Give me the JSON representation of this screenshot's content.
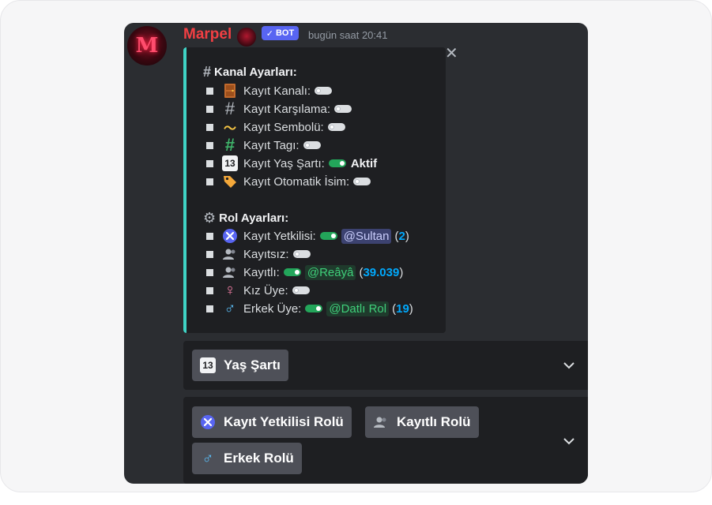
{
  "message": {
    "username": "Marpel",
    "bot_badge": "BOT",
    "timestamp": "bugün saat 20:41",
    "avatar_letter": "M"
  },
  "embed": {
    "channel_heading": "Kanal Ayarları:",
    "channel_items": [
      {
        "label": "Kayıt Kanalı:",
        "icon": "door-icon",
        "toggle": "off"
      },
      {
        "label": "Kayıt Karşılama:",
        "icon": "hash-icon",
        "toggle": "off"
      },
      {
        "label": "Kayıt Sembolü:",
        "icon": "tilde-icon",
        "toggle": "off"
      },
      {
        "label": "Kayıt Tagı:",
        "icon": "green-hash-icon",
        "toggle": "off"
      },
      {
        "label": "Kayıt Yaş Şartı:",
        "icon": "keycap-13-icon",
        "toggle": "on",
        "status": "Aktif"
      },
      {
        "label": "Kayıt Otomatik İsim:",
        "icon": "label-tag-icon",
        "toggle": "off"
      }
    ],
    "role_heading": "Rol Ayarları:",
    "role_items": [
      {
        "label": "Kayıt Yetkilisi:",
        "icon": "tools-icon",
        "toggle": "on",
        "mention": "@Sultan",
        "count": "2"
      },
      {
        "label": "Kayıtsız:",
        "icon": "users-icon",
        "toggle": "off"
      },
      {
        "label": "Kayıtlı:",
        "icon": "users-icon",
        "toggle": "on",
        "mention": "@Reâyâ",
        "count": "39.039"
      },
      {
        "label": "Kız Üye:",
        "icon": "female-sign-icon",
        "toggle": "off"
      },
      {
        "label": "Erkek Üye:",
        "icon": "male-sign-icon",
        "toggle": "on",
        "mention": "@Datlı Rol",
        "count": "19"
      }
    ]
  },
  "components": {
    "row1": {
      "label": "Yaş Şartı",
      "icon": "keycap-13-icon"
    },
    "row2": [
      {
        "label": "Kayıt Yetkilisi Rolü",
        "icon": "tools-icon"
      },
      {
        "label": "Kayıtlı Rolü",
        "icon": "users-icon"
      },
      {
        "label": "Erkek Rolü",
        "icon": "male-sign-icon"
      }
    ]
  },
  "colors": {
    "panel_bg": "#2b2d31",
    "embed_bar": "#3fd3c5",
    "username": "#f23f43",
    "bot_badge": "#5865f2",
    "toggle_on": "#23a55a",
    "count": "#00a8fc"
  },
  "glyphs": {
    "close": "✕",
    "check": "✓",
    "hash": "#",
    "tilde": "〜",
    "female": "♀",
    "male": "♂",
    "keycap": "13",
    "door": "▯",
    "tag": "🏷",
    "tools": "✕",
    "users": "👥",
    "gear": "⚙",
    "chevron": "⌄"
  }
}
